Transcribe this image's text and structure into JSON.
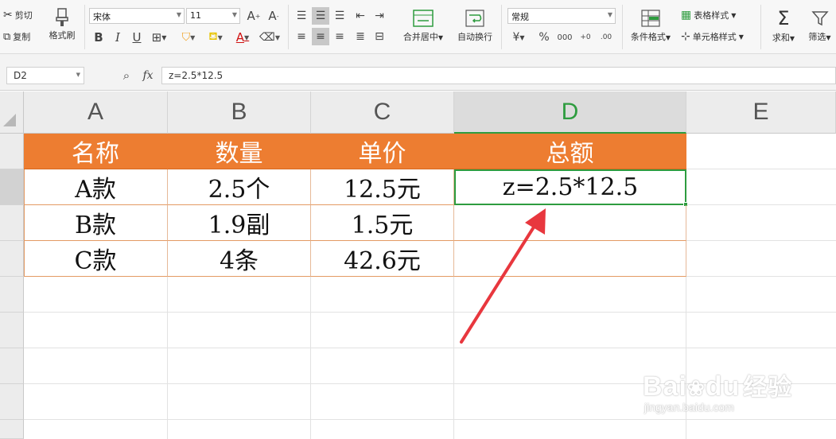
{
  "ribbon": {
    "cut": "剪切",
    "copy": "复制",
    "format_painter": "格式刷",
    "font_name": "宋体",
    "font_size": "11",
    "merge_center": "合并居中",
    "auto_wrap": "自动换行",
    "number_format": "常规",
    "conditional_format": "条件格式",
    "table_style": "表格样式",
    "cell_style": "单元格样式",
    "sum": "求和",
    "filter": "筛选"
  },
  "formula_bar": {
    "name_box": "D2",
    "fx": "fx",
    "formula": "z=2.5*12.5"
  },
  "columns": [
    "A",
    "B",
    "C",
    "D",
    "E"
  ],
  "rows": [
    [
      "名称",
      "数量",
      "单价",
      "总额"
    ],
    [
      "A款",
      "2.5个",
      "12.5元",
      "z=2.5*12.5"
    ],
    [
      "B款",
      "1.9副",
      "1.5元",
      ""
    ],
    [
      "C款",
      "4条",
      "42.6元",
      ""
    ]
  ],
  "watermark": {
    "brand": "Bai",
    "brand2": "du",
    "brand_cn": "经验",
    "url": "jingyan.baidu.com"
  },
  "colors": {
    "header_fill": "#ed7d31",
    "selection": "#2e9c3f",
    "arrow": "#e8373e"
  }
}
